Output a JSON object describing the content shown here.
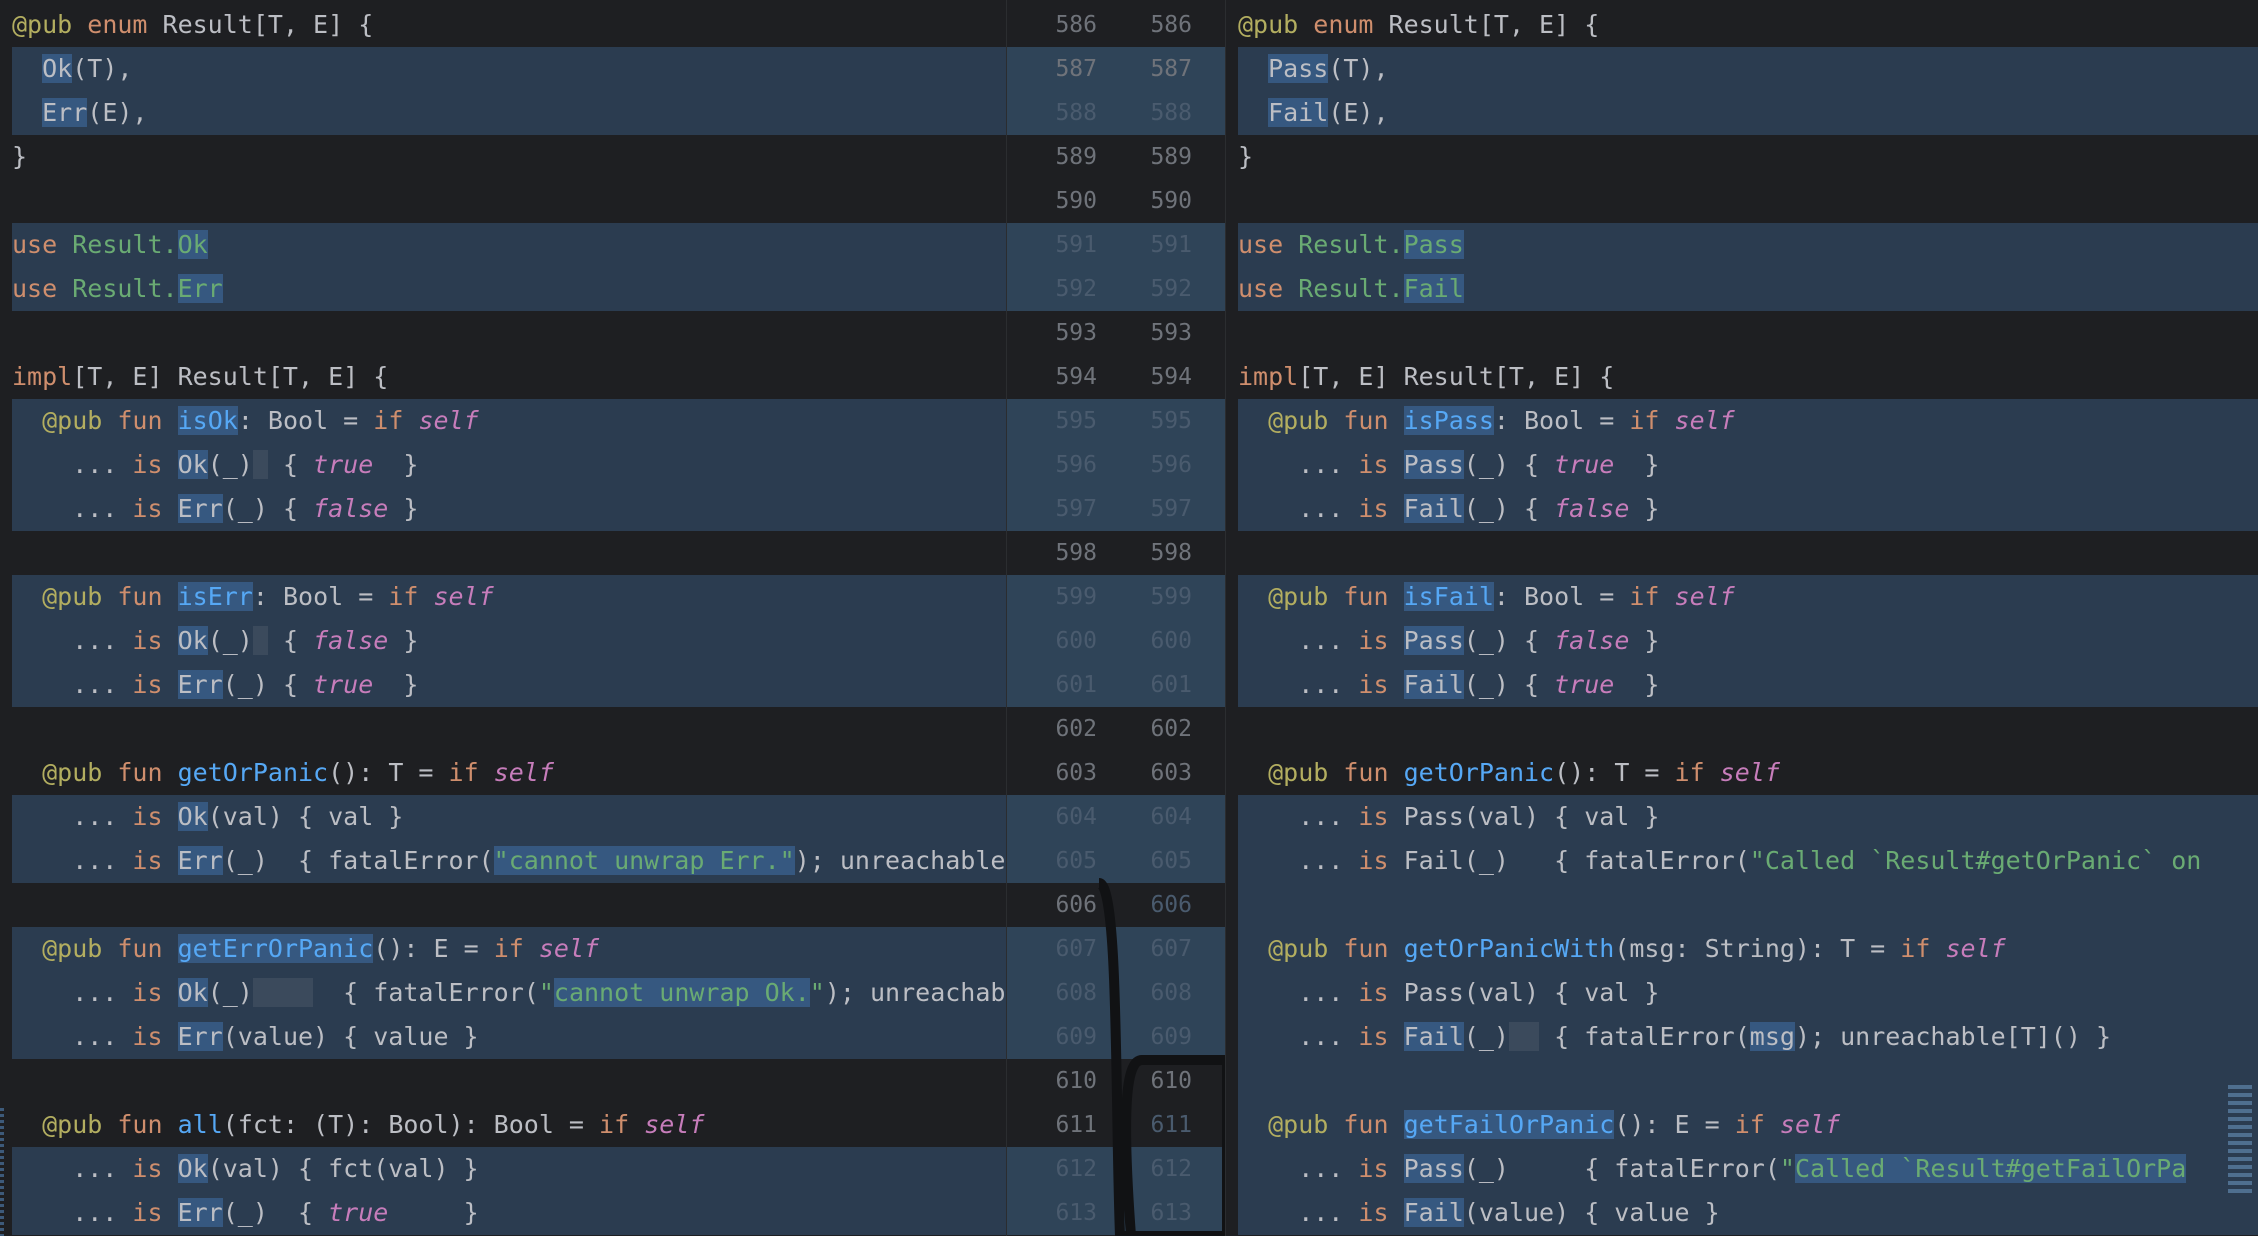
{
  "left": {
    "lines": [
      [
        [
          "ann",
          "@pub "
        ],
        [
          "kw",
          "enum "
        ],
        [
          "",
          "Result[T, E] {"
        ]
      ],
      [
        [
          "",
          "  "
        ],
        [
          "mark",
          "Ok"
        ],
        [
          "",
          "(T),"
        ]
      ],
      [
        [
          "",
          "  "
        ],
        [
          "mark",
          "Err"
        ],
        [
          "",
          "(E),"
        ]
      ],
      [
        [
          "",
          "}"
        ]
      ],
      [
        [
          "",
          ""
        ]
      ],
      [
        [
          "kw",
          "use "
        ],
        [
          "imp",
          "Result."
        ],
        [
          "impmark",
          "Ok"
        ]
      ],
      [
        [
          "kw",
          "use "
        ],
        [
          "imp",
          "Result."
        ],
        [
          "impmark",
          "Err"
        ]
      ],
      [
        [
          "",
          ""
        ]
      ],
      [
        [
          "kw",
          "impl"
        ],
        [
          "",
          "[T, E] Result[T, E] {"
        ]
      ],
      [
        [
          "",
          "  "
        ],
        [
          "ann",
          "@pub "
        ],
        [
          "kw",
          "fun "
        ],
        [
          "fnmark",
          "isOk"
        ],
        [
          "",
          ": Bool = "
        ],
        [
          "kw",
          "if "
        ],
        [
          "it",
          "self"
        ]
      ],
      [
        [
          "",
          "    ... "
        ],
        [
          "kw",
          "is "
        ],
        [
          "mark",
          "Ok"
        ],
        [
          "",
          "(_)"
        ],
        [
          "markdk",
          " "
        ],
        [
          "",
          " { "
        ],
        [
          "it",
          "true"
        ],
        [
          "",
          "  }"
        ]
      ],
      [
        [
          "",
          "    ... "
        ],
        [
          "kw",
          "is "
        ],
        [
          "mark",
          "Err"
        ],
        [
          "",
          "(_) { "
        ],
        [
          "it",
          "false"
        ],
        [
          "",
          " }"
        ]
      ],
      [
        [
          "",
          ""
        ]
      ],
      [
        [
          "",
          "  "
        ],
        [
          "ann",
          "@pub "
        ],
        [
          "kw",
          "fun "
        ],
        [
          "fnmark",
          "isErr"
        ],
        [
          "",
          ": Bool = "
        ],
        [
          "kw",
          "if "
        ],
        [
          "it",
          "self"
        ]
      ],
      [
        [
          "",
          "    ... "
        ],
        [
          "kw",
          "is "
        ],
        [
          "mark",
          "Ok"
        ],
        [
          "",
          "(_)"
        ],
        [
          "markdk",
          " "
        ],
        [
          "",
          " { "
        ],
        [
          "it",
          "false"
        ],
        [
          "",
          " }"
        ]
      ],
      [
        [
          "",
          "    ... "
        ],
        [
          "kw",
          "is "
        ],
        [
          "mark",
          "Err"
        ],
        [
          "",
          "(_) { "
        ],
        [
          "it",
          "true"
        ],
        [
          "",
          "  }"
        ]
      ],
      [
        [
          "",
          ""
        ]
      ],
      [
        [
          "",
          "  "
        ],
        [
          "ann",
          "@pub "
        ],
        [
          "kw",
          "fun "
        ],
        [
          "fn",
          "getOrPanic"
        ],
        [
          "",
          "(): T = "
        ],
        [
          "kw",
          "if "
        ],
        [
          "it",
          "self"
        ]
      ],
      [
        [
          "",
          "    ... "
        ],
        [
          "kw",
          "is "
        ],
        [
          "mark",
          "Ok"
        ],
        [
          "",
          "(val) { val }"
        ]
      ],
      [
        [
          "",
          "    ... "
        ],
        [
          "kw",
          "is "
        ],
        [
          "mark",
          "Err"
        ],
        [
          "",
          "(_)  { fatalError("
        ],
        [
          "strmark",
          "\"cannot unwrap Err.\""
        ],
        [
          "",
          "); unreachable[T]() }"
        ]
      ],
      [
        [
          "",
          ""
        ]
      ],
      [
        [
          "",
          "  "
        ],
        [
          "ann",
          "@pub "
        ],
        [
          "kw",
          "fun "
        ],
        [
          "fnmark",
          "getErrOrPanic"
        ],
        [
          "",
          "(): E = "
        ],
        [
          "kw",
          "if "
        ],
        [
          "it",
          "self"
        ]
      ],
      [
        [
          "",
          "    ... "
        ],
        [
          "kw",
          "is "
        ],
        [
          "mark",
          "Ok"
        ],
        [
          "",
          "(_)"
        ],
        [
          "markdk",
          "    "
        ],
        [
          "",
          "  { fatalError("
        ],
        [
          "str",
          "\""
        ],
        [
          "strmark",
          "cannot unwrap Ok."
        ],
        [
          "str",
          "\""
        ],
        [
          "",
          "); unreachable[E]() }"
        ]
      ],
      [
        [
          "",
          "    ... "
        ],
        [
          "kw",
          "is "
        ],
        [
          "mark",
          "Err"
        ],
        [
          "",
          "(value) { value }"
        ]
      ],
      [
        [
          "",
          ""
        ]
      ],
      [
        [
          "",
          "  "
        ],
        [
          "ann",
          "@pub "
        ],
        [
          "kw",
          "fun "
        ],
        [
          "fn",
          "all"
        ],
        [
          "",
          "(fct: (T): Bool): Bool = "
        ],
        [
          "kw",
          "if "
        ],
        [
          "it",
          "self"
        ]
      ],
      [
        [
          "",
          "    ... "
        ],
        [
          "kw",
          "is "
        ],
        [
          "mark",
          "Ok"
        ],
        [
          "",
          "(val) { fct(val) }"
        ]
      ],
      [
        [
          "",
          "    ... "
        ],
        [
          "kw",
          "is "
        ],
        [
          "mark",
          "Err"
        ],
        [
          "",
          "(_)  { "
        ],
        [
          "it",
          "true"
        ],
        [
          "",
          "     }"
        ]
      ]
    ]
  },
  "right": {
    "lines": [
      [
        [
          "ann",
          "@pub "
        ],
        [
          "kw",
          "enum "
        ],
        [
          "",
          "Result[T, E] {"
        ]
      ],
      [
        [
          "",
          "  "
        ],
        [
          "mark",
          "Pass"
        ],
        [
          "",
          "(T),"
        ]
      ],
      [
        [
          "",
          "  "
        ],
        [
          "mark",
          "Fail"
        ],
        [
          "",
          "(E),"
        ]
      ],
      [
        [
          "",
          "}"
        ]
      ],
      [
        [
          "",
          ""
        ]
      ],
      [
        [
          "kw",
          "use "
        ],
        [
          "imp",
          "Result."
        ],
        [
          "impmark",
          "Pass"
        ]
      ],
      [
        [
          "kw",
          "use "
        ],
        [
          "imp",
          "Result."
        ],
        [
          "impmark",
          "Fail"
        ]
      ],
      [
        [
          "",
          ""
        ]
      ],
      [
        [
          "kw",
          "impl"
        ],
        [
          "",
          "[T, E] Result[T, E] {"
        ]
      ],
      [
        [
          "",
          "  "
        ],
        [
          "ann",
          "@pub "
        ],
        [
          "kw",
          "fun "
        ],
        [
          "fnmark",
          "isPass"
        ],
        [
          "",
          ": Bool = "
        ],
        [
          "kw",
          "if "
        ],
        [
          "it",
          "self"
        ]
      ],
      [
        [
          "",
          "    ... "
        ],
        [
          "kw",
          "is "
        ],
        [
          "mark",
          "Pass"
        ],
        [
          "",
          "(_)"
        ],
        [
          "",
          ""
        ],
        [
          "",
          " { "
        ],
        [
          "it",
          "true"
        ],
        [
          "",
          "  }"
        ]
      ],
      [
        [
          "",
          "    ... "
        ],
        [
          "kw",
          "is "
        ],
        [
          "mark",
          "Fail"
        ],
        [
          "",
          "(_) { "
        ],
        [
          "it",
          "false"
        ],
        [
          "",
          " }"
        ]
      ],
      [
        [
          "",
          ""
        ]
      ],
      [
        [
          "",
          "  "
        ],
        [
          "ann",
          "@pub "
        ],
        [
          "kw",
          "fun "
        ],
        [
          "fnmark",
          "isFail"
        ],
        [
          "",
          ": Bool = "
        ],
        [
          "kw",
          "if "
        ],
        [
          "it",
          "self"
        ]
      ],
      [
        [
          "",
          "    ... "
        ],
        [
          "kw",
          "is "
        ],
        [
          "mark",
          "Pass"
        ],
        [
          "",
          "(_) { "
        ],
        [
          "it",
          "false"
        ],
        [
          "",
          " }"
        ]
      ],
      [
        [
          "",
          "    ... "
        ],
        [
          "kw",
          "is "
        ],
        [
          "mark",
          "Fail"
        ],
        [
          "",
          "(_) { "
        ],
        [
          "it",
          "true"
        ],
        [
          "",
          "  }"
        ]
      ],
      [
        [
          "",
          ""
        ]
      ],
      [
        [
          "",
          "  "
        ],
        [
          "ann",
          "@pub "
        ],
        [
          "kw",
          "fun "
        ],
        [
          "fn",
          "getOrPanic"
        ],
        [
          "",
          "(): T = "
        ],
        [
          "kw",
          "if "
        ],
        [
          "it",
          "self"
        ]
      ],
      [
        [
          "",
          "    ... "
        ],
        [
          "kw",
          "is "
        ],
        [
          "",
          "Pass(val) { val }"
        ]
      ],
      [
        [
          "",
          "    ... "
        ],
        [
          "kw",
          "is "
        ],
        [
          "",
          "Fail(_)   { fatalError("
        ],
        [
          "str",
          "\"Called `Result#getOrPanic` on"
        ]
      ],
      [
        [
          "",
          ""
        ]
      ],
      [
        [
          "",
          "  "
        ],
        [
          "ann",
          "@pub "
        ],
        [
          "kw",
          "fun "
        ],
        [
          "fn",
          "getOrPanicWith"
        ],
        [
          "",
          "(msg: String): T = "
        ],
        [
          "kw",
          "if "
        ],
        [
          "it",
          "self"
        ]
      ],
      [
        [
          "",
          "    ... "
        ],
        [
          "kw",
          "is "
        ],
        [
          "",
          "Pass(val) { val }"
        ]
      ],
      [
        [
          "",
          "    ... "
        ],
        [
          "kw",
          "is "
        ],
        [
          "mark",
          "Fail"
        ],
        [
          "",
          "(_)"
        ],
        [
          "markdk",
          "  "
        ],
        [
          "",
          " { fatalError("
        ],
        [
          "mark",
          "msg"
        ],
        [
          "",
          "); unreachable[T]() }"
        ]
      ],
      [
        [
          "",
          ""
        ]
      ],
      [
        [
          "",
          "  "
        ],
        [
          "ann",
          "@pub "
        ],
        [
          "kw",
          "fun "
        ],
        [
          "fnmark",
          "getFailOrPanic"
        ],
        [
          "",
          "(): E = "
        ],
        [
          "kw",
          "if "
        ],
        [
          "it",
          "self"
        ]
      ],
      [
        [
          "",
          "    ... "
        ],
        [
          "kw",
          "is "
        ],
        [
          "mark",
          "Pass"
        ],
        [
          "",
          "(_)     { fatalError("
        ],
        [
          "str",
          "\""
        ],
        [
          "strmark",
          "Called `Result#getFailOrPa"
        ]
      ],
      [
        [
          "",
          "    ... "
        ],
        [
          "kw",
          "is "
        ],
        [
          "mark",
          "Fail"
        ],
        [
          "",
          "(value) { value }"
        ]
      ]
    ]
  },
  "gutter": {
    "left_numbers": [
      "586",
      "587",
      "588",
      "589",
      "590",
      "591",
      "592",
      "593",
      "594",
      "595",
      "596",
      "597",
      "598",
      "599",
      "600",
      "601",
      "602",
      "603",
      "604",
      "605",
      "606",
      "607",
      "608",
      "609",
      "610",
      "611",
      "612",
      "613"
    ],
    "right_numbers": [
      "586",
      "587",
      "588",
      "589",
      "590",
      "591",
      "592",
      "593",
      "594",
      "595",
      "596",
      "597",
      "598",
      "599",
      "600",
      "601",
      "602",
      "603",
      "604",
      "605",
      "606",
      "607",
      "608",
      "609",
      "610",
      "611",
      "612",
      "613"
    ],
    "dim_rows": [
      2,
      5,
      6,
      9,
      10,
      11,
      13,
      14,
      15,
      18,
      19,
      21,
      22,
      23,
      26,
      27
    ],
    "right_dim_extra": [
      20,
      25
    ]
  },
  "colors": {
    "background": "#1e1f22",
    "change_highlight": "#2b3c50",
    "word_highlight": "#365880",
    "keyword": "#cf8e6d",
    "annotation": "#b3ae60",
    "function": "#56a8f5",
    "italic_value": "#c77dbb",
    "string": "#6aab73"
  }
}
